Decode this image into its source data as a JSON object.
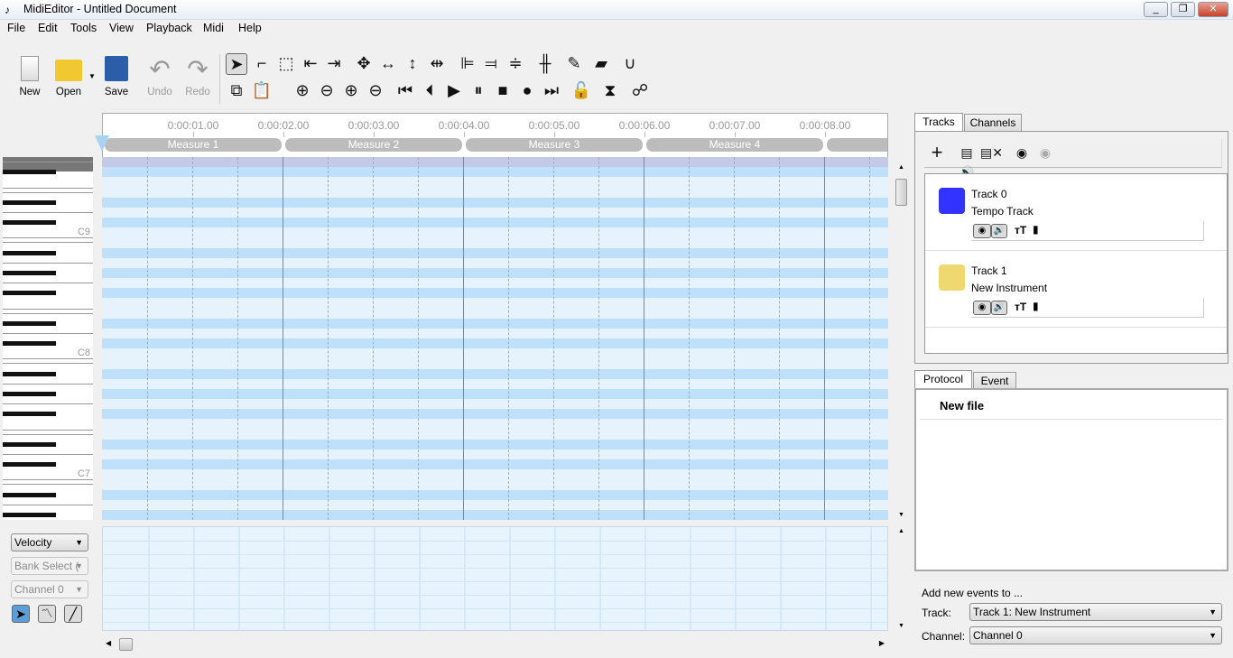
{
  "window": {
    "title": "MidiEditor - Untitled Document",
    "buttons": [
      "minimize",
      "maximize",
      "close"
    ]
  },
  "menu": [
    "File",
    "Edit",
    "Tools",
    "View",
    "Playback",
    "Midi",
    "Help"
  ],
  "toolbar": {
    "file_buttons": [
      {
        "label": "New",
        "icon": "new-file-icon"
      },
      {
        "label": "Open",
        "icon": "folder-open-icon"
      },
      {
        "label": "Save",
        "icon": "save-icon"
      },
      {
        "label": "Undo",
        "icon": "undo-icon",
        "disabled": true
      },
      {
        "label": "Redo",
        "icon": "redo-icon",
        "disabled": true
      }
    ],
    "row1_icons": [
      "select-single-icon",
      "select-box-icon",
      "select-rect-icon",
      "select-left-icon",
      "select-right-icon",
      "move-all-icon",
      "move-horizontal-icon",
      "move-vertical-icon",
      "size-change-icon",
      "align-left-icon",
      "align-right-icon",
      "equalize-icon",
      "glue-icon",
      "pencil-icon",
      "eraser-icon",
      "magnet-icon"
    ],
    "row2_icons": [
      "copy-icon",
      "paste-icon",
      "zoom-in-vertical-icon",
      "zoom-out-vertical-icon",
      "zoom-in-horizontal-icon",
      "zoom-out-horizontal-icon",
      "skip-to-start-icon",
      "step-back-icon",
      "play-icon",
      "pause-icon",
      "stop-icon",
      "record-icon",
      "skip-forward-icon",
      "lock-icon",
      "metronome-icon",
      "connect-icon"
    ]
  },
  "ruler": {
    "times": [
      "0:00:01.00",
      "0:00:02.00",
      "0:00:03.00",
      "0:00:04.00",
      "0:00:05.00",
      "0:00:06.00",
      "0:00:07.00",
      "0:00:08.00"
    ],
    "measures": [
      "Measure 1",
      "Measure 2",
      "Measure 3",
      "Measure 4",
      ""
    ]
  },
  "piano": {
    "labels": [
      "C9",
      "C8",
      "C7"
    ]
  },
  "controls": {
    "misc_mode": "Velocity",
    "control": "Bank Select (",
    "channel": "Channel 0",
    "tools": [
      "select-tool-icon",
      "free-draw-icon",
      "line-draw-icon"
    ]
  },
  "tracks_panel": {
    "tabs": [
      "Tracks",
      "Channels"
    ],
    "active_tab": "Tracks",
    "toolbar_icons": [
      "add-track-icon",
      "all-audible-icon",
      "all-mute-icon",
      "all-visible-icon",
      "all-hidden-icon"
    ],
    "tracks": [
      {
        "number": "Track 0",
        "name": "Tempo Track",
        "color": "#3333ff"
      },
      {
        "number": "Track 1",
        "name": "New Instrument",
        "color": "#f0d870"
      }
    ]
  },
  "protocol_panel": {
    "tabs": [
      "Protocol",
      "Event"
    ],
    "active_tab": "Protocol",
    "entries": [
      "New file"
    ]
  },
  "add_events": {
    "heading": "Add new events to ...",
    "track_label": "Track:",
    "track_value": "Track 1: New Instrument",
    "channel_label": "Channel:",
    "channel_value": "Channel 0"
  },
  "colors": {
    "black_key_row": "#bfe0fb",
    "white_key_row": "#e6f3fd",
    "highlight_row": "#c3c9e6"
  }
}
